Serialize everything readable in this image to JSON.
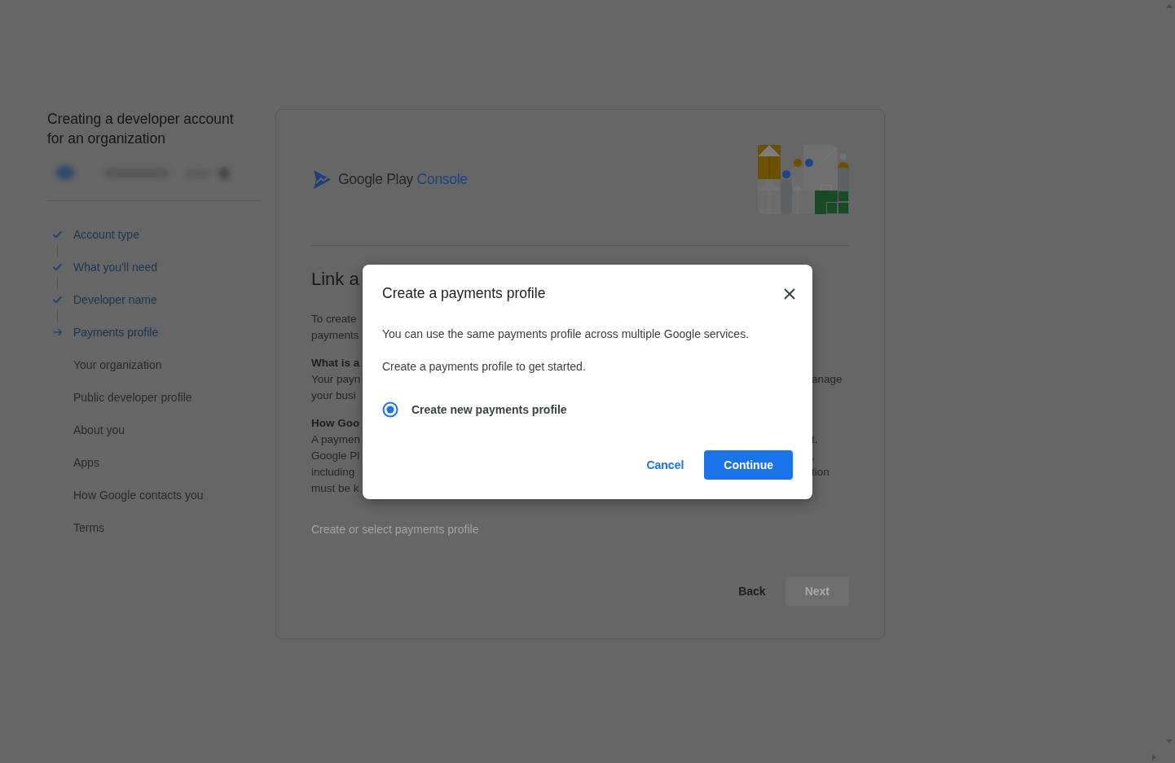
{
  "sidebar": {
    "title": "Creating a developer account for an organization",
    "steps": [
      {
        "label": "Account type",
        "done": true,
        "current": false
      },
      {
        "label": "What you'll need",
        "done": true,
        "current": false
      },
      {
        "label": "Developer name",
        "done": true,
        "current": false
      },
      {
        "label": "Payments profile",
        "done": false,
        "current": true
      },
      {
        "label": "Your organization",
        "done": false,
        "current": false
      },
      {
        "label": "Public developer profile",
        "done": false,
        "current": false
      },
      {
        "label": "About you",
        "done": false,
        "current": false
      },
      {
        "label": "Apps",
        "done": false,
        "current": false
      },
      {
        "label": "How Google contacts you",
        "done": false,
        "current": false
      },
      {
        "label": "Terms",
        "done": false,
        "current": false
      }
    ]
  },
  "card": {
    "logo": {
      "brand": "Google Play",
      "product": "Console"
    },
    "heading": "Link a",
    "paragraphs": [
      {
        "lines": [
          {
            "left": "To create"
          },
          {
            "left": "payments"
          }
        ]
      },
      {
        "heading": "What is a",
        "lines": [
          {
            "left": "Your payn",
            "right": "anage"
          },
          {
            "left": "your busi"
          }
        ]
      },
      {
        "heading": "How Goo",
        "lines": [
          {
            "left": "A paymen",
            "right": "t."
          },
          {
            "left": "Google Pl",
            "right": ","
          },
          {
            "left": "including",
            "right": "tion"
          },
          {
            "left": "must be k"
          }
        ]
      }
    ],
    "profile_action": {
      "label": "Create or select payments profile",
      "disabled": true
    },
    "buttons": [
      {
        "label": "Back",
        "kind": "text",
        "disabled": false
      },
      {
        "label": "Next",
        "kind": "filled",
        "disabled": true
      }
    ]
  },
  "dialog": {
    "title": "Create a payments profile",
    "paragraphs": [
      "You can use the same payments profile across multiple Google services.",
      "Create a payments profile to get started."
    ],
    "options": [
      {
        "label": "Create new payments profile",
        "selected": true
      }
    ],
    "buttons": [
      {
        "label": "Cancel",
        "kind": "text"
      },
      {
        "label": "Continue",
        "kind": "filled"
      }
    ]
  }
}
